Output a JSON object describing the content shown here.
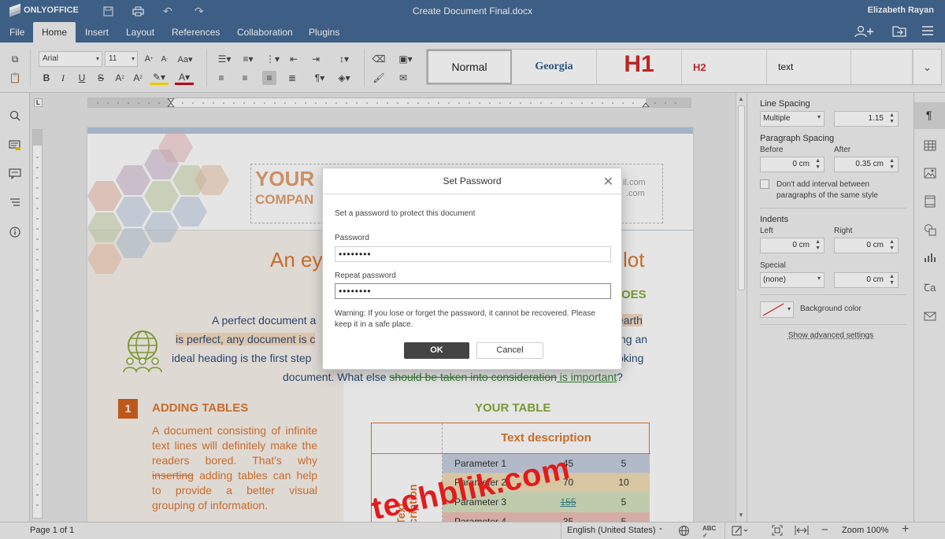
{
  "window": {
    "app_name": "ONLYOFFICE",
    "document_title": "Create Document Final.docx",
    "user_name": "Elizabeth Rayan"
  },
  "menu": {
    "items": [
      "File",
      "Home",
      "Insert",
      "Layout",
      "References",
      "Collaboration",
      "Plugins"
    ],
    "active": "Home"
  },
  "toolbar": {
    "font_name": "Arial",
    "font_size": "11"
  },
  "styles_gallery": [
    "Normal",
    "Georgia",
    "H1",
    "H2",
    "text"
  ],
  "document": {
    "logo_line1": "YOUR",
    "logo_line2": "COMPAN",
    "contact_line1": "il.com",
    "contact_line2": ".com",
    "heading_left": "An ey",
    "heading_right": "lot",
    "subheading_right": "OES",
    "para_line1": "A perfect document a",
    "para_line1_end": "earth",
    "para_line2": "is perfect, any document is c",
    "para_line2_end": "ng an",
    "para_line3": "ideal heading is the first step",
    "para_line3_end": "oking",
    "para_line4_a": "document. What else ",
    "para_line4_strike": "should be taken into consideration",
    "para_line4_b": " is important",
    "para_line4_c": "?",
    "section_number": "1",
    "section_title": "ADDING TABLES",
    "section_text_a": "A document consisting of infinite text lines will definitely make the readers bored. That's why ",
    "section_text_strike": "inserting",
    "section_text_b": " adding tables can help to provide a better visual grouping of information.",
    "table_title": "YOUR TABLE",
    "table_header": "Text description",
    "table_side": "Text description",
    "table_rows": [
      {
        "param": "Parameter 1",
        "v1": "45",
        "v2": "5"
      },
      {
        "param": "Parameter 2",
        "v1": "70",
        "v2": "10"
      },
      {
        "param": "Parameter 3",
        "v1": "155",
        "v2": "5"
      },
      {
        "param": "Parameter 4",
        "v1": "35",
        "v2": "5"
      }
    ]
  },
  "right_panel": {
    "line_spacing_label": "Line Spacing",
    "line_spacing_mode": "Multiple",
    "line_spacing_value": "1.15",
    "para_spacing_label": "Paragraph Spacing",
    "before_label": "Before",
    "after_label": "After",
    "before_value": "0 cm",
    "after_value": "0.35 cm",
    "no_interval_label": "Don't add interval between paragraphs of the same style",
    "indents_label": "Indents",
    "left_label": "Left",
    "right_label": "Right",
    "left_value": "0 cm",
    "right_value": "0 cm",
    "special_label": "Special",
    "special_mode": "(none)",
    "special_value": "0 cm",
    "bg_color_label": "Background color",
    "advanced_link": "Show advanced settings"
  },
  "dialog": {
    "title": "Set Password",
    "description": "Set a password to protect this document",
    "password_label": "Password",
    "password_value": "••••••••",
    "repeat_label": "Repeat password",
    "repeat_value": "••••••••",
    "warning": "Warning: If you lose or forget the password, it cannot be recovered. Please keep it in a safe place.",
    "ok": "OK",
    "cancel": "Cancel"
  },
  "statusbar": {
    "page": "Page 1 of 1",
    "language": "English (United States)",
    "zoom": "Zoom 100%"
  },
  "watermark": "techblik.com",
  "colors": {
    "header": "#446995",
    "accent_orange": "#e5782f",
    "accent_green": "#8aab3b",
    "text_blue": "#2f4f7a"
  }
}
